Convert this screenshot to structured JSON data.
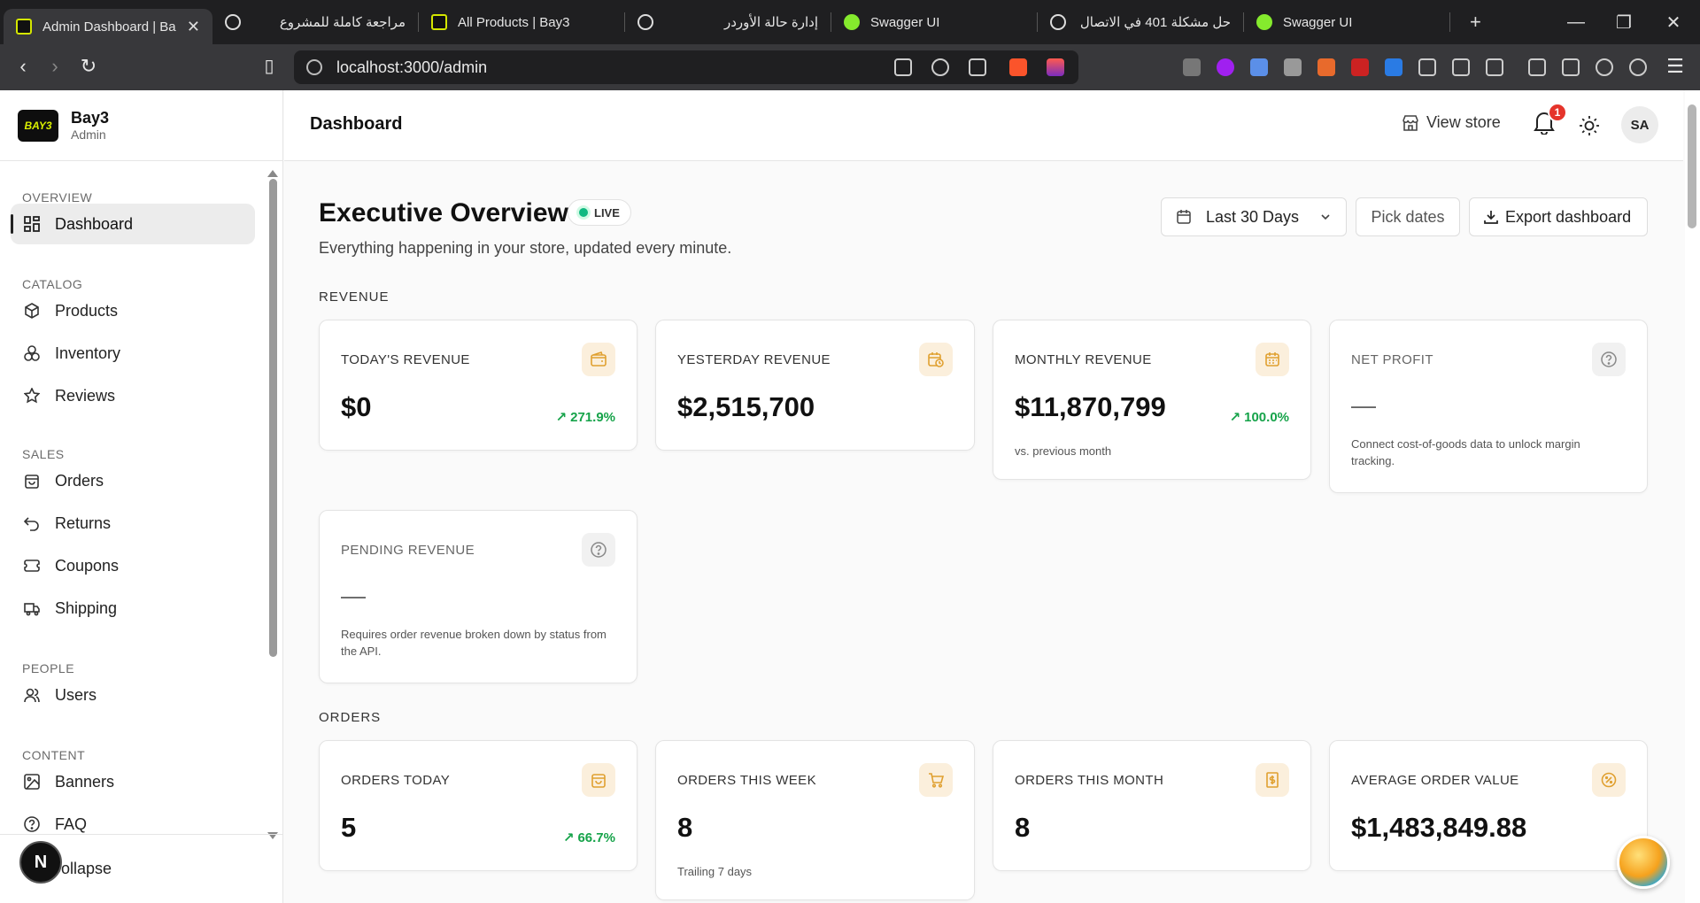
{
  "browser": {
    "tabs": [
      {
        "title": "Admin Dashboard | Ba",
        "favicon": "bay3"
      },
      {
        "title": "مراجعة كاملة للمشروع",
        "favicon": "chatgpt"
      },
      {
        "title": "All Products | Bay3",
        "favicon": "bay3"
      },
      {
        "title": "إدارة حالة الأوردر",
        "favicon": "chatgpt"
      },
      {
        "title": "Swagger UI",
        "favicon": "swagger"
      },
      {
        "title": "حل مشكلة 401 في الاتصال",
        "favicon": "chatgpt"
      },
      {
        "title": "Swagger UI",
        "favicon": "swagger"
      }
    ],
    "new_tab": "+",
    "url": "localhost:3000/admin"
  },
  "sidebar": {
    "brand_logo": "BAY3",
    "brand_name": "Bay3",
    "brand_sub": "Admin",
    "sections": {
      "overview": "OVERVIEW",
      "catalog": "CATALOG",
      "sales": "SALES",
      "people": "PEOPLE",
      "content": "CONTENT"
    },
    "items": {
      "dashboard": "Dashboard",
      "products": "Products",
      "inventory": "Inventory",
      "reviews": "Reviews",
      "orders": "Orders",
      "returns": "Returns",
      "coupons": "Coupons",
      "shipping": "Shipping",
      "users": "Users",
      "banners": "Banners",
      "faq": "FAQ"
    },
    "collapse": "Collapse",
    "n_badge": "N"
  },
  "topbar": {
    "title": "Dashboard",
    "view_store": "View store",
    "notification_count": "1",
    "avatar": "SA"
  },
  "overview": {
    "title": "Executive Overview",
    "live": "LIVE",
    "subtitle": "Everything happening in your store, updated every minute.",
    "range": "Last 30 Days",
    "pick_dates": "Pick dates",
    "export": "Export dashboard"
  },
  "revenue": {
    "label": "REVENUE",
    "today": {
      "title": "TODAY'S REVENUE",
      "value": "$0",
      "trend": "271.9%"
    },
    "yesterday": {
      "title": "YESTERDAY REVENUE",
      "value": "$2,515,700"
    },
    "monthly": {
      "title": "MONTHLY REVENUE",
      "value": "$11,870,799",
      "trend": "100.0%",
      "note": "vs. previous month"
    },
    "net_profit": {
      "title": "NET PROFIT",
      "value": "—",
      "note": "Connect cost-of-goods data to unlock margin tracking."
    },
    "pending": {
      "title": "PENDING REVENUE",
      "value": "—",
      "note": "Requires order revenue broken down by status from the API."
    }
  },
  "orders": {
    "label": "ORDERS",
    "today": {
      "title": "ORDERS TODAY",
      "value": "5",
      "trend": "66.7%"
    },
    "week": {
      "title": "ORDERS THIS WEEK",
      "value": "8",
      "note": "Trailing 7 days"
    },
    "month": {
      "title": "ORDERS THIS MONTH",
      "value": "8"
    },
    "aov": {
      "title": "AVERAGE ORDER VALUE",
      "value": "$1,483,849.88"
    }
  },
  "colors": {
    "accent_icon_bg": "#fbefdc",
    "accent_icon": "#e0a030",
    "trend_up": "#16a34a",
    "live": "#10b981",
    "badge": "#e5342b"
  }
}
